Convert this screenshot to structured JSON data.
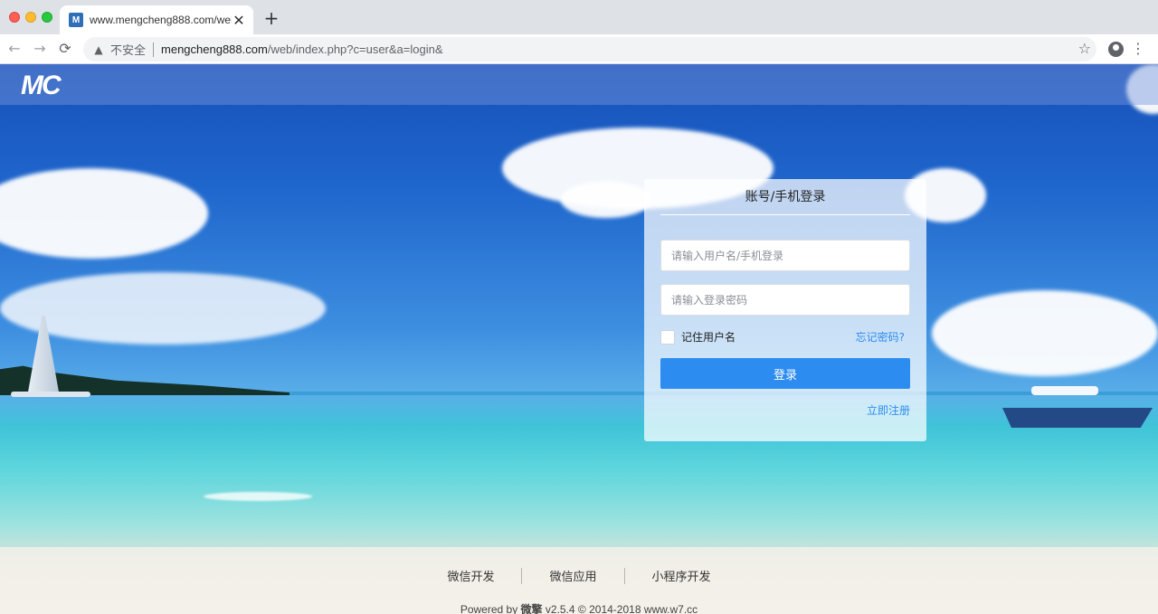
{
  "browser": {
    "tab_title": "www.mengcheng888.com/web/index.php?c=user&a=login&",
    "favicon_text": "M",
    "close_glyph": "✕",
    "newtab_glyph": "+",
    "back_glyph": "←",
    "forward_glyph": "→",
    "reload_glyph": "⟳",
    "warning_glyph": "▲",
    "insecure_label": "不安全",
    "url_host": "mengcheng888.com",
    "url_path": "/web/index.php?c=user&a=login&",
    "star_glyph": "☆",
    "menu_glyph": "⋮"
  },
  "header": {
    "logo_text": "MC"
  },
  "login": {
    "title": "账号/手机登录",
    "username_placeholder": "请输入用户名/手机登录",
    "password_placeholder": "请输入登录密码",
    "remember_label": "记住用户名",
    "forgot_label": "忘记密码?",
    "submit_label": "登录",
    "register_label": "立即注册",
    "accent_color": "#2d8cf0"
  },
  "footer": {
    "links": [
      "微信开发",
      "微信应用",
      "小程序开发"
    ],
    "powered_by": "Powered by",
    "brand": "微擎",
    "version_text": "v2.5.4 © 2014-2018 www.w7.cc"
  }
}
